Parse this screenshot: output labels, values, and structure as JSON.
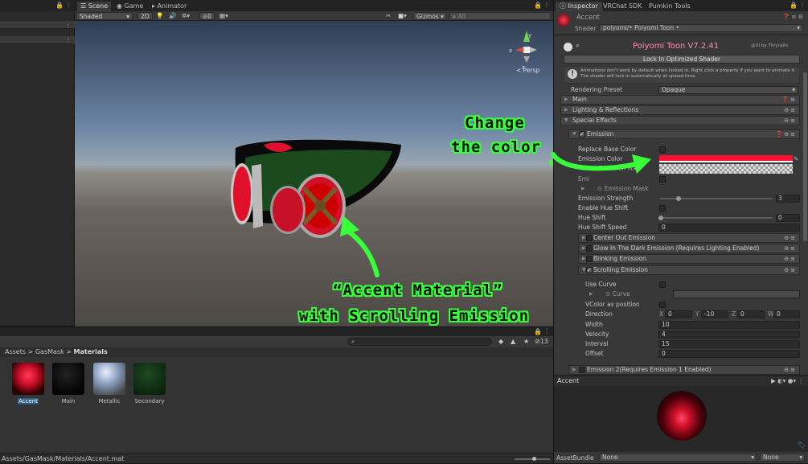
{
  "hierarchy": {
    "rows": [
      "",
      ""
    ]
  },
  "scene": {
    "tabs": [
      "Scene",
      "Game",
      "Animator"
    ],
    "shading": "Shaded",
    "mode_2d": "2D",
    "gizmos": "Gizmos",
    "search_all": "All",
    "persp": "< Persp",
    "hidden_count": "0"
  },
  "annotations": {
    "change_color_line1": "Change",
    "change_color_line2": "the color",
    "accent_line1": "“Accent Material”",
    "accent_line2": "with Scrolling Emission"
  },
  "project": {
    "breadcrumb": [
      "Assets",
      "GasMask",
      "Materials"
    ],
    "count": "13",
    "assets": [
      {
        "name": "Accent",
        "selected": true
      },
      {
        "name": "Main",
        "selected": false
      },
      {
        "name": "Metallic",
        "selected": false
      },
      {
        "name": "Secondary",
        "selected": false
      }
    ],
    "status_path": "Assets/GasMask/Materials/Accent.mat"
  },
  "inspector": {
    "tabs": [
      "Inspector",
      "VRChat SDK",
      "Pumkin Tools"
    ],
    "material_name": "Accent",
    "shader_label": "Shader",
    "shader_value": "poiyomi/• Poiyomi Toon •",
    "title": "Poiyomi Toon V7.2.41",
    "credit": "@UI by Thryrallo",
    "lock_button": "Lock In Optimized Shader",
    "info_text": "Animations don't work by default when locked in. Right click a property if you want to animate it. The shader will lock in automatically at upload time.",
    "rendering_preset_label": "Rendering Preset",
    "rendering_preset_value": "Opaque",
    "sections": {
      "main": "Main",
      "lighting": "Lighting & Reflections",
      "special": "Special Effects",
      "emission": "Emission"
    },
    "emission": {
      "replace_base": "Replace Base Color",
      "emission_color": "Emission Color",
      "emission_map": "Emission Map",
      "emission_mask": "Emission Mask",
      "strength_label": "Emission Strength",
      "strength_value": "3",
      "hue_shift_enable": "Enable Hue Shift",
      "hue_shift": "Hue Shift",
      "hue_shift_value": "0",
      "hue_shift_speed": "Hue Shift Speed",
      "hue_shift_speed_value": "0",
      "color_hex": "#ff1030"
    },
    "subsections": {
      "center_out": "Center Out Emission",
      "glow_dark": "Glow In The Dark Emission (Requires Lighting Enabled)",
      "blinking": "Blinking Emission",
      "scrolling": "Scrolling Emission"
    },
    "scrolling": {
      "use_curve": "Use Curve",
      "curve": "Curve",
      "vcolor": "VColor as position",
      "direction": "Direction",
      "dir_x": "0",
      "dir_y": "-10",
      "dir_z": "0",
      "dir_w": "0",
      "width_label": "Width",
      "width": "10",
      "velocity_label": "Velocity",
      "velocity": "4",
      "interval_label": "Interval",
      "interval": "15",
      "offset_label": "Offset",
      "offset": "0"
    },
    "emission2": "Emission 2(Requires Emission 1 Enabled)",
    "preview_name": "Accent",
    "assetbundle_label": "AssetBundle",
    "assetbundle_value": "None",
    "assetbundle_variant": "None"
  }
}
